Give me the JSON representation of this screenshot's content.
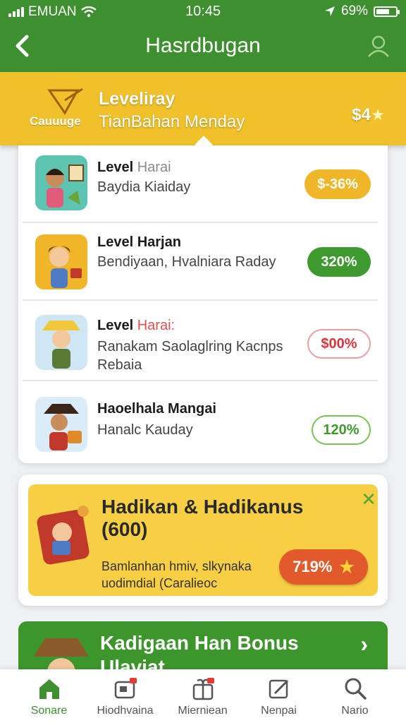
{
  "status_bar": {
    "carrier": "EMUAN",
    "time": "10:45",
    "battery": "69%",
    "battery_level": 0.69
  },
  "app_bar": {
    "title": "Hasrdbugan"
  },
  "banner": {
    "badge": "Cauuuge",
    "title": "Leveliray",
    "subtitle": "TianBahan Menday",
    "price": "$4",
    "star": "★"
  },
  "rows": [
    {
      "title_bold": "Level",
      "title_rest": "Harai",
      "description": "Baydia Kiaiday",
      "pill": "$-36%",
      "pill_style": "yellow"
    },
    {
      "title_bold": "Level Harjan",
      "title_rest": "",
      "description": "Bendiyaan, Hvalniara Raday",
      "pill": "320%",
      "pill_style": "green"
    },
    {
      "title_bold": "Level",
      "title_rest": "Harai:",
      "description": "Ranakam Saolaglring Kacnps Rebaia",
      "pill": "$00%",
      "pill_style": "red-outline"
    },
    {
      "title_bold": "Haoelhala Mangai",
      "title_rest": "",
      "description": "Hanalc Kauday",
      "pill": "120%",
      "pill_style": "green-outline"
    }
  ],
  "promo": {
    "title": "Hadikan & Hadikanus",
    "count": "(600)",
    "description": "Bamlanhan hmiv, slkynaka uodimdial (Caralieoc",
    "button": "719%",
    "close": "✕"
  },
  "bonus": {
    "title": "Kadigaan Han Bonus Ulaviat",
    "chevron": "›"
  },
  "tabs": [
    {
      "label": "Sonare",
      "icon": "home-icon",
      "active": true
    },
    {
      "label": "Hiodhvaina",
      "icon": "wallet-icon",
      "active": false
    },
    {
      "label": "Mierniean",
      "icon": "gift-icon",
      "active": false
    },
    {
      "label": "Nenpai",
      "icon": "edit-icon",
      "active": false
    },
    {
      "label": "Nario",
      "icon": "search-icon",
      "active": false
    }
  ],
  "colors": {
    "primary": "#3d8f2f",
    "banner": "#f0c12a",
    "accent_orange": "#e25a2c",
    "pill_yellow": "#f0b62a",
    "pill_green": "#3e9a2e",
    "pill_red": "#e05050"
  }
}
